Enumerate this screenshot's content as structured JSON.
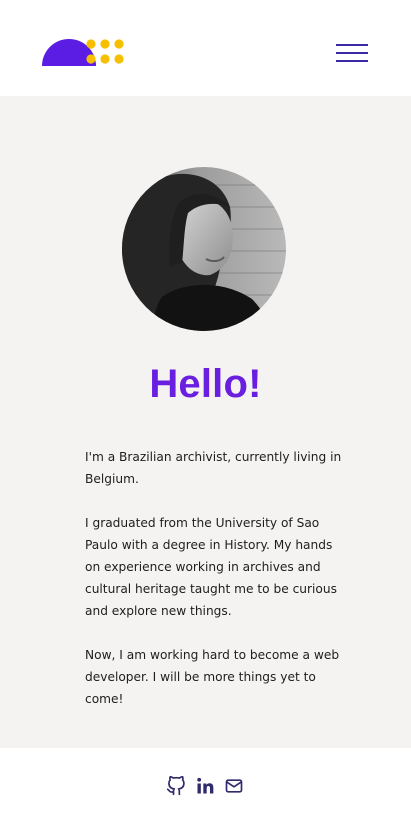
{
  "header": {
    "logo_icon": "half-circle-dots-logo",
    "menu_icon": "hamburger-menu-icon"
  },
  "profile": {
    "photo_alt": "Portrait photo",
    "greeting": "Hello!",
    "bio": [
      "I'm a Brazilian archivist, currently living in Belgium.",
      "I graduated from the University of Sao Paulo with a degree in History. My hands on experience working in archives and cultural heritage taught me to be curious and explore new things.",
      "Now, I am working hard to become a web developer. I will be more things yet to come!"
    ]
  },
  "footer": {
    "links": [
      {
        "icon": "github-icon"
      },
      {
        "icon": "linkedin-icon"
      },
      {
        "icon": "mail-icon"
      }
    ]
  },
  "colors": {
    "accent_purple": "#6a1fe0",
    "logo_purple": "#5b1de3",
    "logo_yellow": "#f6c000",
    "menu_navy": "#3a2aa6",
    "main_background": "#f5f3f1"
  }
}
